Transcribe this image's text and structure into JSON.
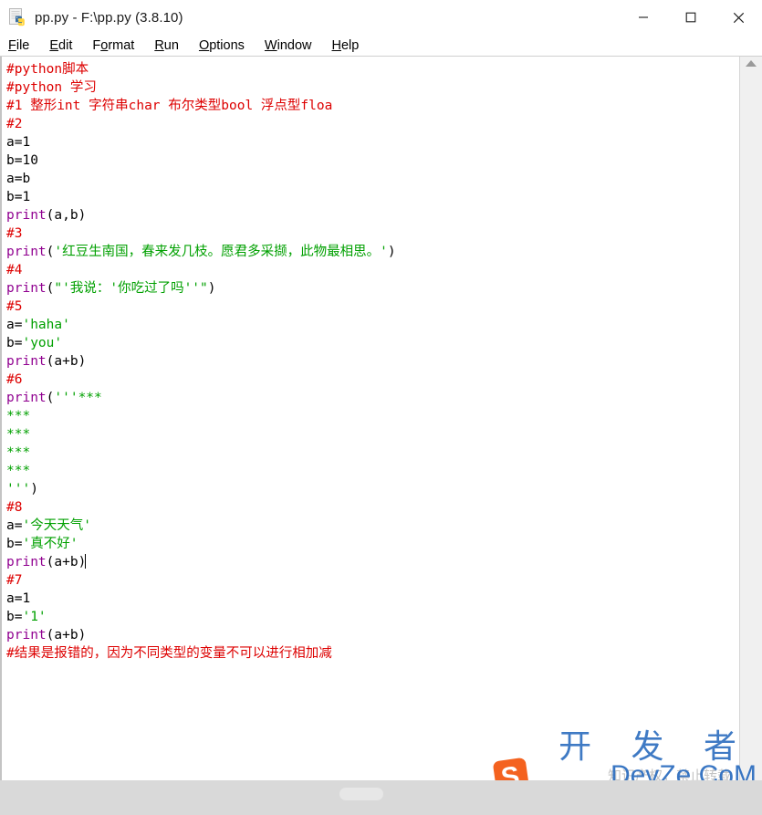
{
  "window": {
    "title": "pp.py - F:\\pp.py (3.8.10)",
    "icon_name": "python-idle-file-icon",
    "controls": {
      "minimize": "minimize-icon",
      "maximize": "maximize-icon",
      "close": "close-icon"
    }
  },
  "menu": {
    "items": [
      {
        "label": "File",
        "acc": "F",
        "rest": "ile"
      },
      {
        "label": "Edit",
        "acc": "E",
        "rest": "dit"
      },
      {
        "label": "Format",
        "pre": "F",
        "acc": "o",
        "rest": "rmat"
      },
      {
        "label": "Run",
        "acc": "R",
        "rest": "un"
      },
      {
        "label": "Options",
        "acc": "O",
        "rest": "ptions"
      },
      {
        "label": "Window",
        "acc": "W",
        "rest": "indow"
      },
      {
        "label": "Help",
        "acc": "H",
        "rest": "elp"
      }
    ]
  },
  "colors": {
    "comment": "#dd0000",
    "string": "#00a000",
    "builtin": "#900090",
    "plain": "#000000",
    "background": "#ffffff"
  },
  "editor": {
    "lines": [
      [
        {
          "t": "#python脚本",
          "c": "comment"
        }
      ],
      [
        {
          "t": "#python 学习",
          "c": "comment"
        }
      ],
      [
        {
          "t": "#1 整形int 字符串char 布尔类型bool 浮点型floa",
          "c": "comment"
        }
      ],
      [
        {
          "t": "#2",
          "c": "comment"
        }
      ],
      [
        {
          "t": "a=1",
          "c": "plain"
        }
      ],
      [
        {
          "t": "b=10",
          "c": "plain"
        }
      ],
      [
        {
          "t": "a=b",
          "c": "plain"
        }
      ],
      [
        {
          "t": "b=1",
          "c": "plain"
        }
      ],
      [
        {
          "t": "print",
          "c": "builtin"
        },
        {
          "t": "(a,b)",
          "c": "plain"
        }
      ],
      [
        {
          "t": "#3",
          "c": "comment"
        }
      ],
      [
        {
          "t": "print",
          "c": "builtin"
        },
        {
          "t": "(",
          "c": "plain"
        },
        {
          "t": "'红豆生南国，春来发几枝。愿君多采撷，此物最相思。'",
          "c": "string"
        },
        {
          "t": ")",
          "c": "plain"
        }
      ],
      [
        {
          "t": "#4",
          "c": "comment"
        }
      ],
      [
        {
          "t": "print",
          "c": "builtin"
        },
        {
          "t": "(",
          "c": "plain"
        },
        {
          "t": "\"'我说：'你吃过了吗''\"",
          "c": "string"
        },
        {
          "t": ")",
          "c": "plain"
        }
      ],
      [
        {
          "t": "#5",
          "c": "comment"
        }
      ],
      [
        {
          "t": "a=",
          "c": "plain"
        },
        {
          "t": "'haha'",
          "c": "string"
        }
      ],
      [
        {
          "t": "b=",
          "c": "plain"
        },
        {
          "t": "'you'",
          "c": "string"
        }
      ],
      [
        {
          "t": "print",
          "c": "builtin"
        },
        {
          "t": "(a+b)",
          "c": "plain"
        }
      ],
      [
        {
          "t": "#6",
          "c": "comment"
        }
      ],
      [
        {
          "t": "print",
          "c": "builtin"
        },
        {
          "t": "(",
          "c": "plain"
        },
        {
          "t": "'''***",
          "c": "string"
        }
      ],
      [
        {
          "t": "***",
          "c": "string"
        }
      ],
      [
        {
          "t": "***",
          "c": "string"
        }
      ],
      [
        {
          "t": "***",
          "c": "string"
        }
      ],
      [
        {
          "t": "***",
          "c": "string"
        }
      ],
      [
        {
          "t": "'''",
          "c": "string"
        },
        {
          "t": ")",
          "c": "plain"
        }
      ],
      [
        {
          "t": "#8",
          "c": "comment"
        }
      ],
      [
        {
          "t": "a=",
          "c": "plain"
        },
        {
          "t": "'今天天气'",
          "c": "string"
        }
      ],
      [
        {
          "t": "b=",
          "c": "plain"
        },
        {
          "t": "'真不好'",
          "c": "string"
        }
      ],
      [
        {
          "t": "print",
          "c": "builtin"
        },
        {
          "t": "(a+b)",
          "c": "plain"
        },
        {
          "t": "",
          "c": "caret"
        }
      ],
      [
        {
          "t": "#7",
          "c": "comment"
        }
      ],
      [
        {
          "t": "a=1",
          "c": "plain"
        }
      ],
      [
        {
          "t": "b=",
          "c": "plain"
        },
        {
          "t": "'1'",
          "c": "string"
        }
      ],
      [
        {
          "t": "print",
          "c": "builtin"
        },
        {
          "t": "(a+b)",
          "c": "plain"
        }
      ],
      [
        {
          "t": "#结果是报错的，因为不同类型的变量不可以进行相加减",
          "c": "comment"
        }
      ]
    ]
  },
  "watermark": {
    "cn_text": "开 发 者",
    "sub_text": "DevZe.CoM",
    "ghost_text": "知识产权，禁止转载",
    "logo_letter": "S"
  }
}
